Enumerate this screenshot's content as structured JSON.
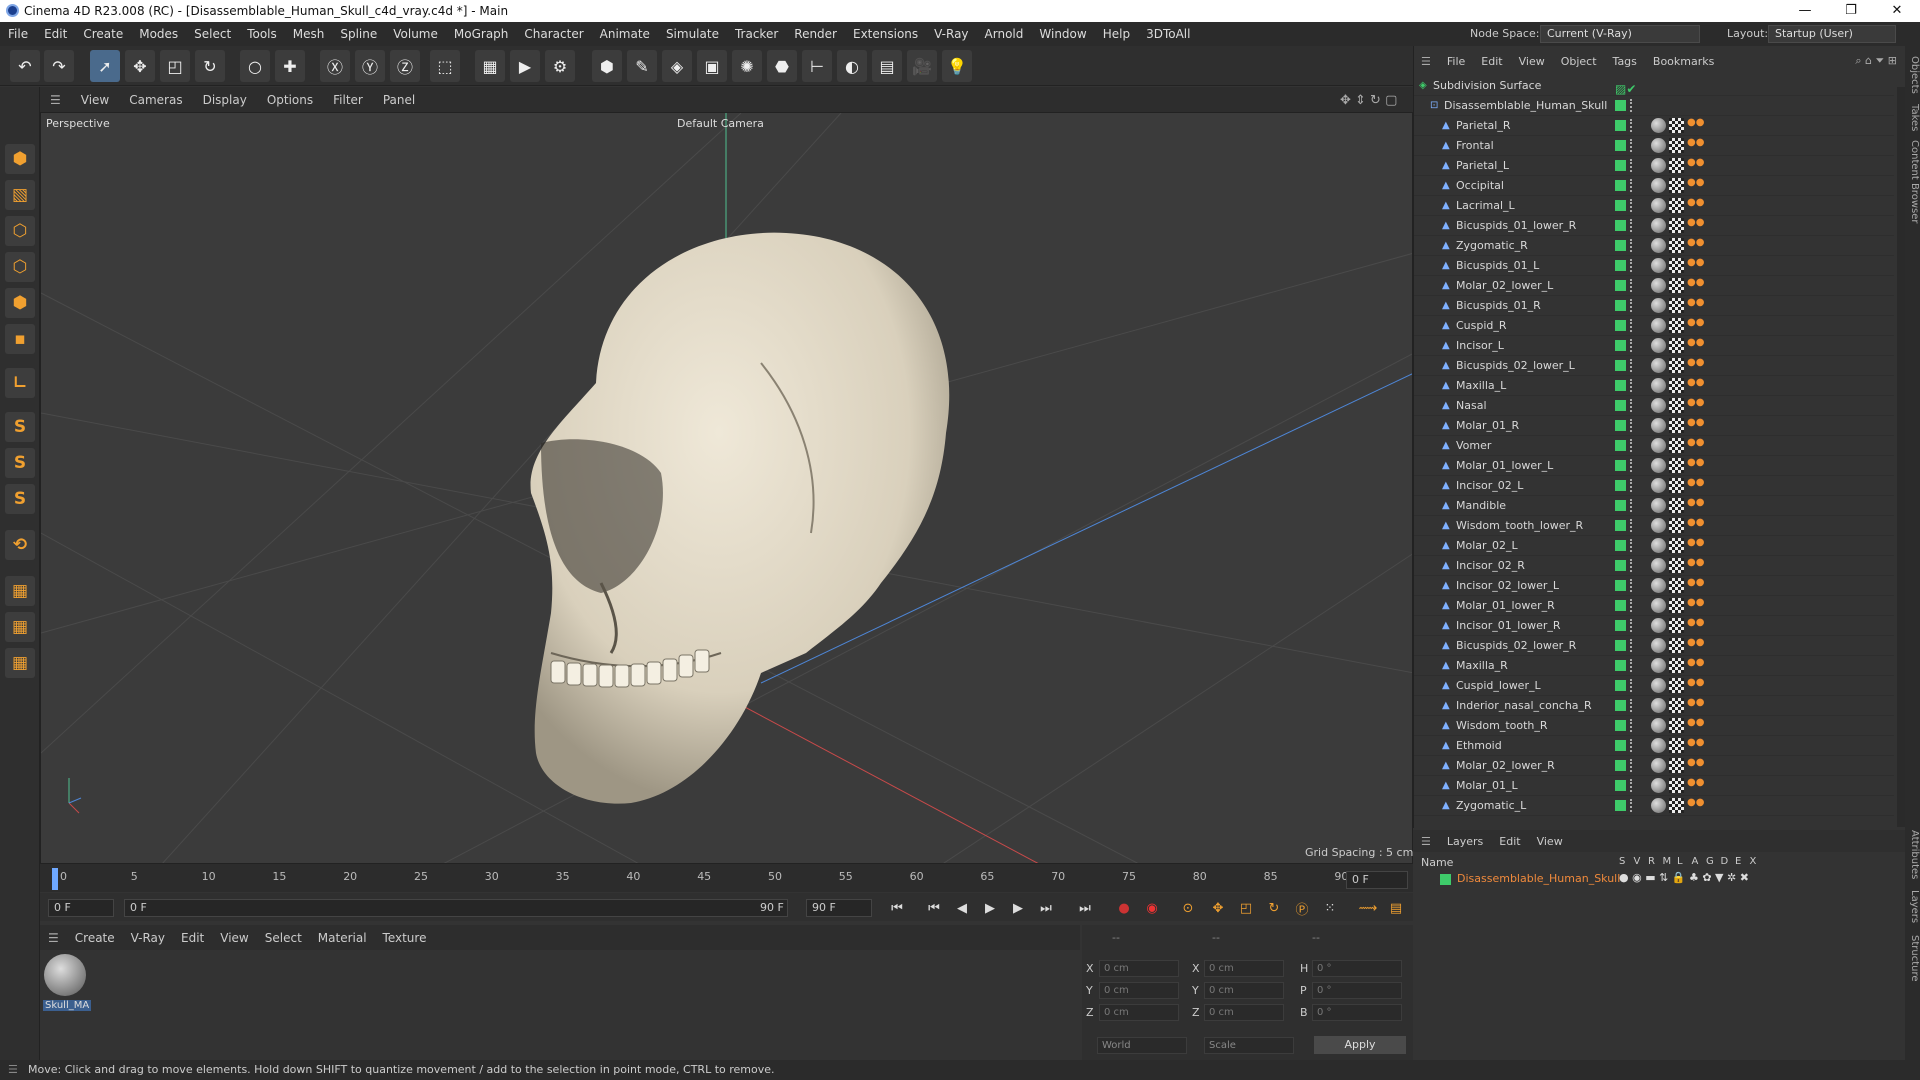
{
  "titlebar": {
    "title": "Cinema 4D R23.008 (RC) - [Disassemblable_Human_Skull_c4d_vray.c4d *] - Main"
  },
  "menu": [
    "File",
    "Edit",
    "Create",
    "Modes",
    "Select",
    "Tools",
    "Mesh",
    "Spline",
    "Volume",
    "MoGraph",
    "Character",
    "Animate",
    "Simulate",
    "Tracker",
    "Render",
    "Extensions",
    "V-Ray",
    "Arnold",
    "Window",
    "Help",
    "3DToAll"
  ],
  "nodespace": {
    "label": "Node Space:",
    "value": "Current (V-Ray)"
  },
  "layout": {
    "label": "Layout:",
    "value": "Startup (User)"
  },
  "viewport": {
    "menu": [
      "View",
      "Cameras",
      "Display",
      "Options",
      "Filter",
      "Panel"
    ],
    "name": "Perspective",
    "camera": "Default Camera",
    "grid_spacing": "Grid Spacing : 5 cm"
  },
  "timeline": {
    "ticks": [
      "0",
      "5",
      "10",
      "15",
      "20",
      "25",
      "30",
      "35",
      "40",
      "45",
      "50",
      "55",
      "60",
      "65",
      "70",
      "75",
      "80",
      "85",
      "90"
    ],
    "end_frame": "0 F"
  },
  "transport": {
    "start": "0 F",
    "current": "0 F",
    "range_end": "90 F",
    "end": "90 F"
  },
  "material": {
    "menu": [
      "Create",
      "V-Ray",
      "Edit",
      "View",
      "Select",
      "Material",
      "Texture"
    ],
    "item": "Skull_MA"
  },
  "coords": {
    "header": [
      "--",
      "--",
      "--"
    ],
    "x": "0 cm",
    "y": "0 cm",
    "z": "0 cm",
    "sx": "0 cm",
    "sy": "0 cm",
    "sz": "0 cm",
    "h": "0 °",
    "p": "0 °",
    "b": "0 °",
    "world": "World",
    "scale": "Scale",
    "apply": "Apply"
  },
  "objects": {
    "menu": [
      "File",
      "Edit",
      "View",
      "Object",
      "Tags",
      "Bookmarks"
    ],
    "root": "Subdivision Surface",
    "group": "Disassemblable_Human_Skull",
    "items": [
      "Parietal_R",
      "Frontal",
      "Parietal_L",
      "Occipital",
      "Lacrimal_L",
      "Bicuspids_01_lower_R",
      "Zygomatic_R",
      "Bicuspids_01_L",
      "Molar_02_lower_L",
      "Bicuspids_01_R",
      "Cuspid_R",
      "Incisor_L",
      "Bicuspids_02_lower_L",
      "Maxilla_L",
      "Nasal",
      "Molar_01_R",
      "Vomer",
      "Molar_01_lower_L",
      "Incisor_02_L",
      "Mandible",
      "Wisdom_tooth_lower_R",
      "Molar_02_L",
      "Incisor_02_R",
      "Incisor_02_lower_L",
      "Molar_01_lower_R",
      "Incisor_01_lower_R",
      "Bicuspids_02_lower_R",
      "Maxilla_R",
      "Cuspid_lower_L",
      "Inderior_nasal_concha_R",
      "Wisdom_tooth_R",
      "Ethmoid",
      "Molar_02_lower_R",
      "Molar_01_L",
      "Zygomatic_L"
    ]
  },
  "layers": {
    "menu": [
      "Layers",
      "Edit",
      "View"
    ],
    "name_header": "Name",
    "cols": [
      "S",
      "V",
      "R",
      "M",
      "L",
      "A",
      "G",
      "D",
      "E",
      "X"
    ],
    "layer": "Disassemblable_Human_Skull"
  },
  "right_tabs": [
    "Objects",
    "Takes",
    "Content Browser",
    "Attributes",
    "Layers",
    "Structure"
  ],
  "status": "Move: Click and drag to move elements. Hold down SHIFT to quantize movement / add to the selection in point mode, CTRL to remove."
}
